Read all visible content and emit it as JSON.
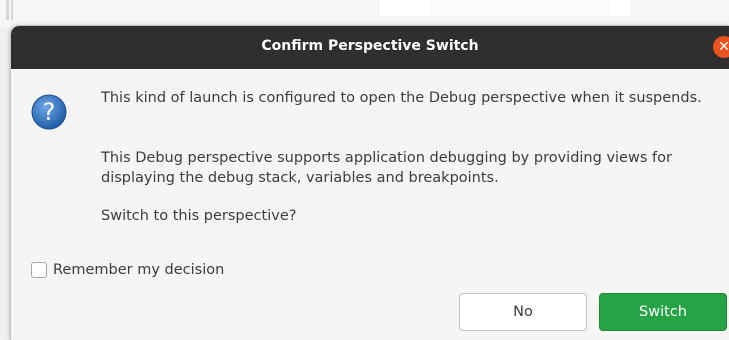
{
  "dialog": {
    "title": "Confirm Perspective Switch",
    "close_icon": "close-icon",
    "question_icon": "question-icon",
    "message_1": "This kind of launch is configured to open the Debug perspective when it suspends.",
    "message_2": "This Debug perspective supports application debugging by providing views for displaying the debug stack, variables and breakpoints.",
    "message_3": "Switch to this perspective?",
    "remember_label": "Remember my decision",
    "remember_checked": false,
    "buttons": {
      "no_label": "No",
      "switch_label": "Switch"
    },
    "colors": {
      "titlebar": "#2f2f2f",
      "close": "#e95420",
      "switch_button": "#26a445",
      "question_icon": "#2c6fb7"
    }
  }
}
